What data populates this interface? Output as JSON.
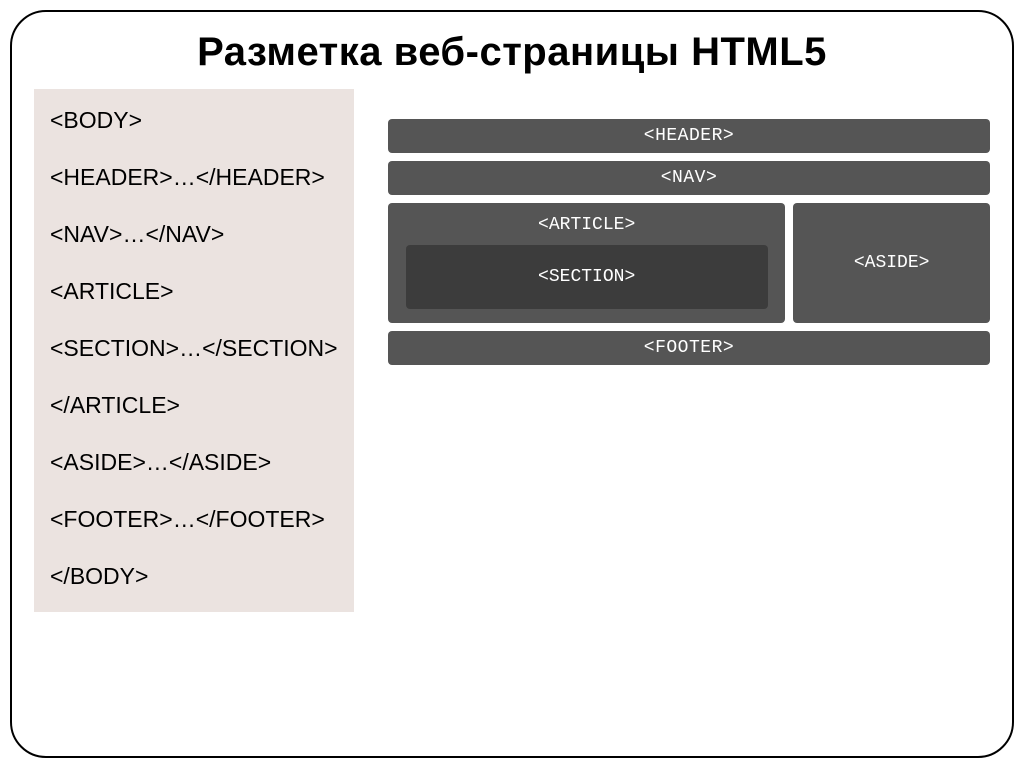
{
  "title": "Разметка веб-страницы HTML5",
  "code": {
    "l1": "<BODY>",
    "l2": "<HEADER>…</HEADER>",
    "l3": "<NAV>…</NAV>",
    "l4": "<ARTICLE>",
    "l5": "<SECTION>…</SECTION>",
    "l6": "</ARTICLE>",
    "l7": "<ASIDE>…</ASIDE>",
    "l8": "<FOOTER>…</FOOTER>",
    "l9": "</BODY>"
  },
  "diagram": {
    "header": "<HEADER>",
    "nav": "<NAV>",
    "article": "<ARTICLE>",
    "section": "<SECTION>",
    "aside": "<ASIDE>",
    "footer": "<FOOTER>"
  }
}
